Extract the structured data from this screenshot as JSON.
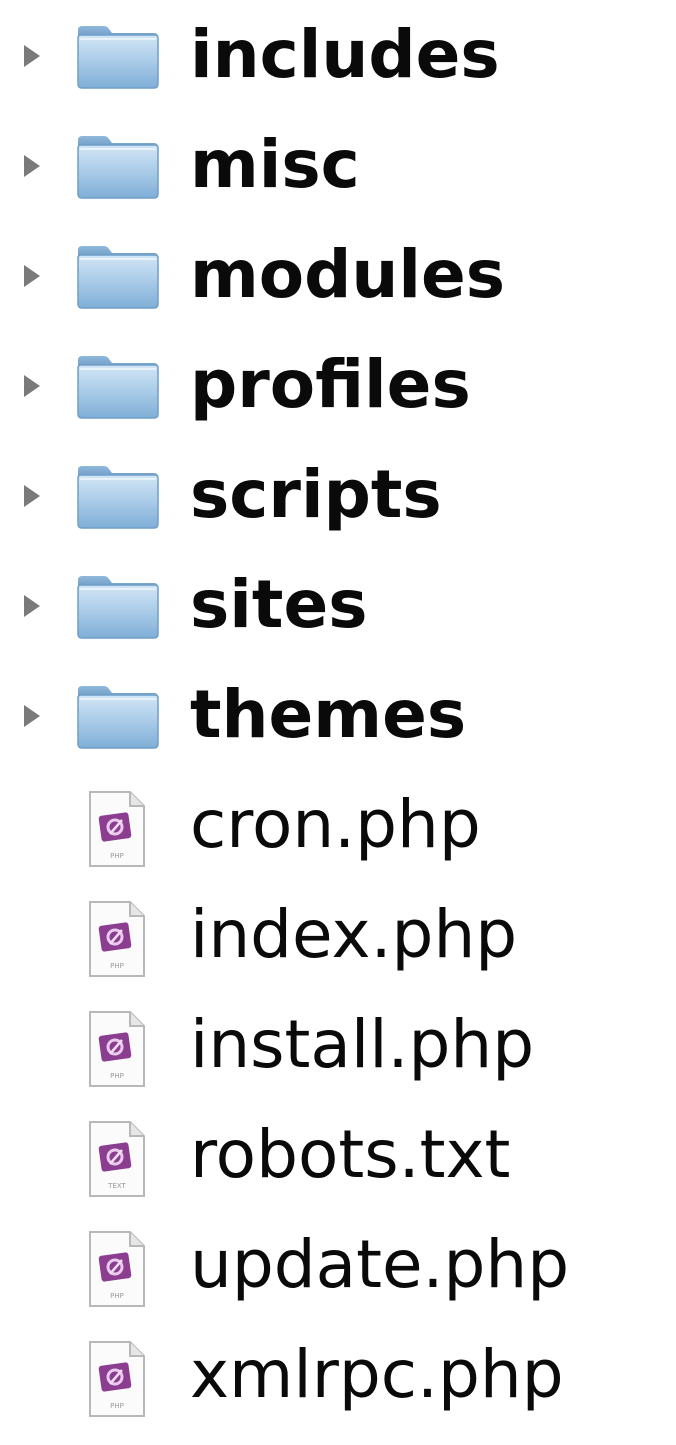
{
  "items": [
    {
      "type": "folder",
      "name": "includes"
    },
    {
      "type": "folder",
      "name": "misc"
    },
    {
      "type": "folder",
      "name": "modules"
    },
    {
      "type": "folder",
      "name": "profiles"
    },
    {
      "type": "folder",
      "name": "scripts"
    },
    {
      "type": "folder",
      "name": "sites"
    },
    {
      "type": "folder",
      "name": "themes"
    },
    {
      "type": "file",
      "name": "cron.php",
      "badge": "PHP"
    },
    {
      "type": "file",
      "name": "index.php",
      "badge": "PHP"
    },
    {
      "type": "file",
      "name": "install.php",
      "badge": "PHP"
    },
    {
      "type": "file",
      "name": "robots.txt",
      "badge": "TEXT"
    },
    {
      "type": "file",
      "name": "update.php",
      "badge": "PHP"
    },
    {
      "type": "file",
      "name": "xmlrpc.php",
      "badge": "PHP"
    }
  ],
  "colors": {
    "folder_light": "#b9d6ee",
    "folder_dark": "#6f9fc8",
    "file_accent": "#8b3d8f",
    "disclosure": "#7a7a7a"
  },
  "icons": {
    "folder": "folder-icon",
    "file": "php-file-icon",
    "disclosure": "disclosure-triangle-icon"
  }
}
